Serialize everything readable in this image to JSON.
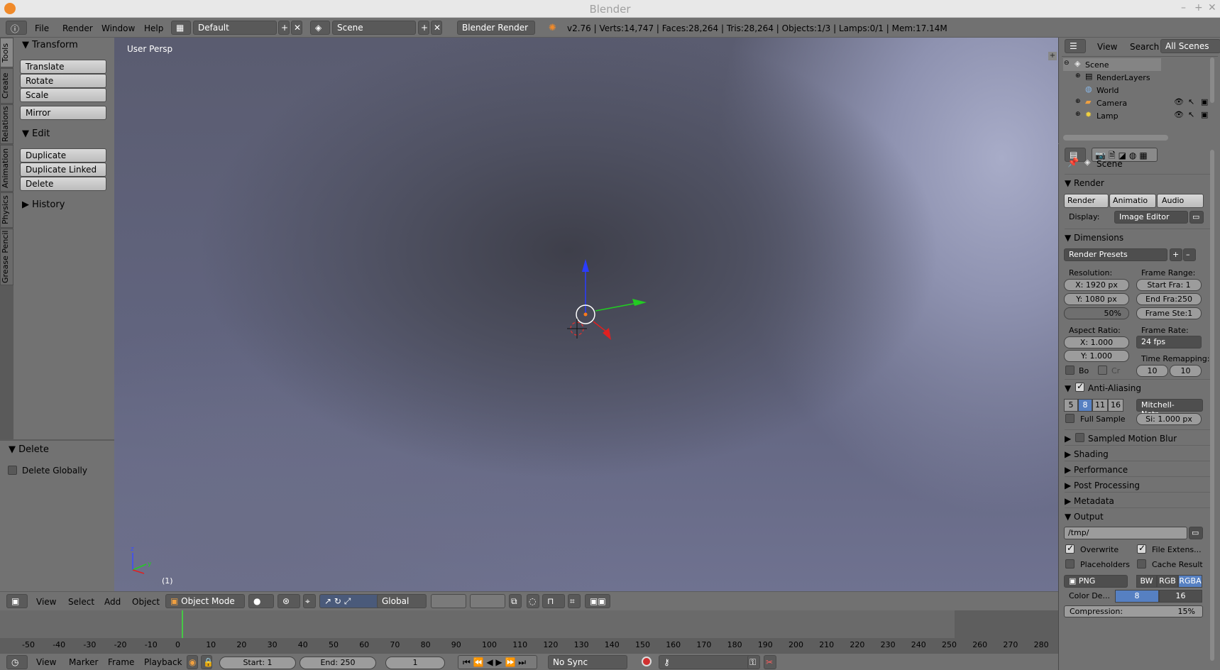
{
  "window": {
    "title": "Blender"
  },
  "topbar": {
    "menus": [
      "File",
      "Render",
      "Window",
      "Help"
    ],
    "layout": "Default",
    "scene": "Scene",
    "engine": "Blender Render",
    "stats": "v2.76 | Verts:14,747 | Faces:28,264 | Tris:28,264 | Objects:1/3 | Lamps:0/1 | Mem:17.14M"
  },
  "tool_tabs": [
    "Tools",
    "Create",
    "Relations",
    "Animation",
    "Physics",
    "Grease Pencil"
  ],
  "tools": {
    "transform": {
      "header": "Transform",
      "buttons": [
        "Translate",
        "Rotate",
        "Scale",
        "Mirror"
      ]
    },
    "edit": {
      "header": "Edit",
      "buttons": [
        "Duplicate",
        "Duplicate Linked",
        "Delete"
      ]
    },
    "history": {
      "header": "History"
    }
  },
  "operator": {
    "header": "Delete",
    "option": "Delete Globally",
    "option_checked": false
  },
  "viewport": {
    "label": "User Persp",
    "frame_label": "(1)"
  },
  "view3d_header": {
    "menus": [
      "View",
      "Select",
      "Add",
      "Object"
    ],
    "mode": "Object Mode",
    "orientation": "Global"
  },
  "timeline": {
    "ticks": [
      "-50",
      "-40",
      "-30",
      "-20",
      "-10",
      "0",
      "10",
      "20",
      "30",
      "40",
      "50",
      "60",
      "70",
      "80",
      "90",
      "100",
      "110",
      "120",
      "130",
      "140",
      "150",
      "160",
      "170",
      "180",
      "190",
      "200",
      "210",
      "220",
      "230",
      "240",
      "250",
      "260",
      "270",
      "280"
    ],
    "menus": [
      "View",
      "Marker",
      "Frame",
      "Playback"
    ],
    "start_label": "Start:",
    "start": "1",
    "end_label": "End:",
    "end": "250",
    "current": "1",
    "sync": "No Sync"
  },
  "outliner": {
    "menus": [
      "View",
      "Search"
    ],
    "filter": "All Scenes",
    "items": [
      {
        "label": "Scene",
        "icon": "scene-icon"
      },
      {
        "label": "RenderLayers",
        "icon": "renderlayers-icon"
      },
      {
        "label": "World",
        "icon": "world-icon"
      },
      {
        "label": "Camera",
        "icon": "camera-icon"
      },
      {
        "label": "Lamp",
        "icon": "lamp-icon"
      }
    ]
  },
  "properties": {
    "context": "Scene",
    "render": {
      "header": "Render",
      "buttons": [
        "Render",
        "Animatio",
        "Audio"
      ],
      "display_label": "Display:",
      "display": "Image Editor"
    },
    "dimensions": {
      "header": "Dimensions",
      "presets": "Render Presets",
      "resolution_label": "Resolution:",
      "res_x": "X:  1920 px",
      "res_y": "Y:  1080 px",
      "res_pct": "50%",
      "frame_range_label": "Frame Range:",
      "start": "Start Fra:   1",
      "end": "End Fra:250",
      "step": "Frame Ste:1",
      "aspect_label": "Aspect Ratio:",
      "asp_x": "X:    1.000",
      "asp_y": "Y:    1.000",
      "framerate_label": "Frame Rate:",
      "fps": "24 fps",
      "remap_label": "Time Remapping:",
      "remap_old": "10",
      "remap_new": "10",
      "border": "Bo",
      "crop": "Cr"
    },
    "aa": {
      "header": "Anti-Aliasing",
      "samples": [
        "5",
        "8",
        "11",
        "16"
      ],
      "selected": "8",
      "filter": "Mitchell-Netr...",
      "full_sample": "Full Sample",
      "size": "Si: 1.000 px"
    },
    "collapsed": [
      "Sampled Motion Blur",
      "Shading",
      "Performance",
      "Post Processing",
      "Metadata"
    ],
    "output": {
      "header": "Output",
      "path": "/tmp/",
      "overwrite": "Overwrite",
      "file_ext": "File Extens...",
      "placeholders": "Placeholders",
      "cache": "Cache Result",
      "format": "PNG",
      "color_modes": [
        "BW",
        "RGB",
        "RGBA"
      ],
      "color_selected": "RGBA",
      "depth_label": "Color De...",
      "depths": [
        "8",
        "16"
      ],
      "depth_selected": "8",
      "compression": "Compression:",
      "compression_val": "15%"
    }
  }
}
